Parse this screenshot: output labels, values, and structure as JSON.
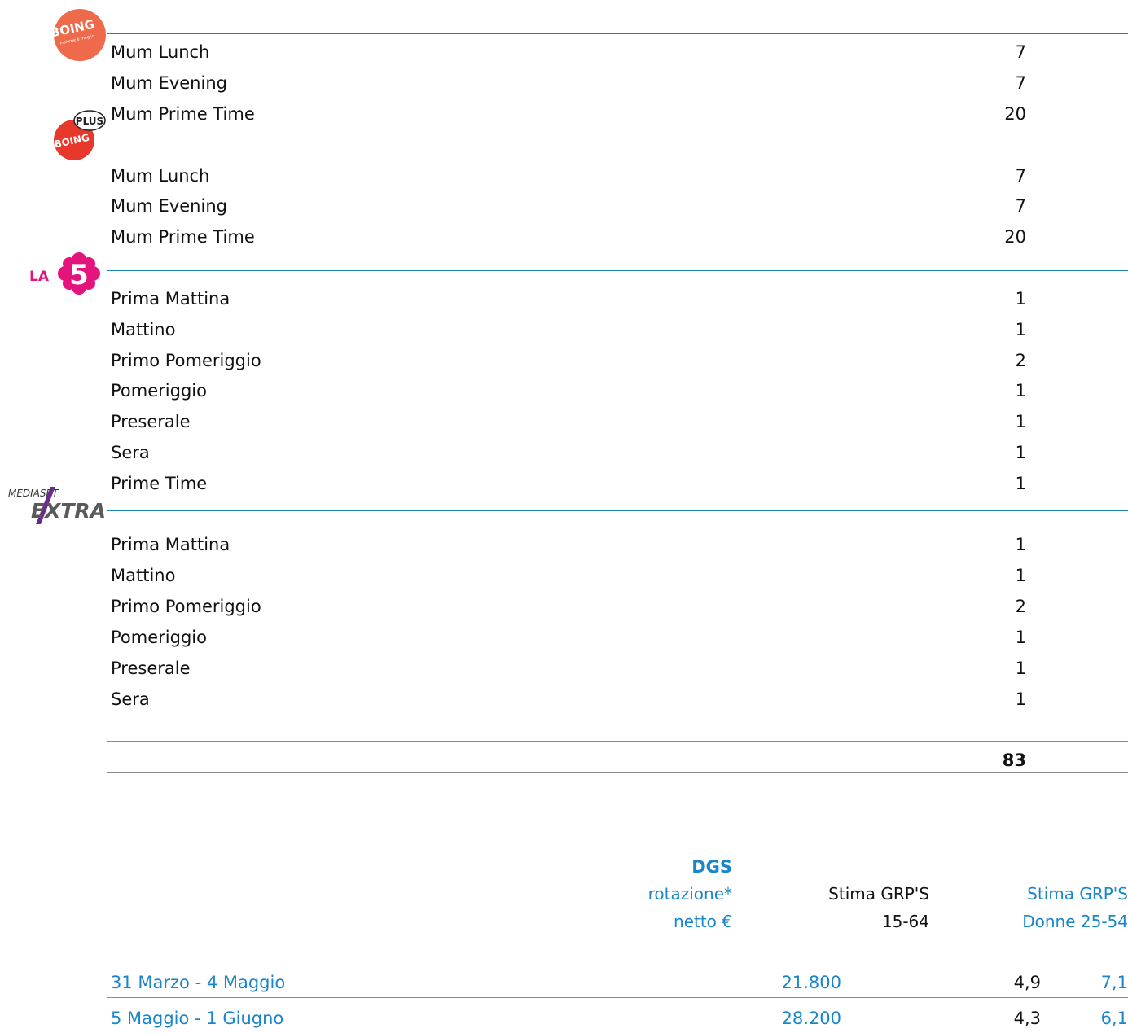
{
  "logos": {
    "boing": {
      "name": "BOING",
      "tagline": "Insieme è meglio"
    },
    "boing_plus": {
      "name": "BOING",
      "badge": "PLUS"
    },
    "la5": {
      "prefix": "LA",
      "number": "5"
    },
    "mediaset_extra": {
      "top": "MEDIASET",
      "name": "EXTRA"
    }
  },
  "sections": [
    {
      "rows": [
        {
          "label": "Mum Lunch",
          "value": "7"
        },
        {
          "label": "Mum Evening",
          "value": "7"
        },
        {
          "label": "Mum Prime Time",
          "value": "20"
        }
      ]
    },
    {
      "rows": [
        {
          "label": "Mum Lunch",
          "value": "7"
        },
        {
          "label": "Mum Evening",
          "value": "7"
        },
        {
          "label": "Mum Prime Time",
          "value": "20"
        }
      ]
    },
    {
      "rows": [
        {
          "label": "Prima Mattina",
          "value": "1"
        },
        {
          "label": "Mattino",
          "value": "1"
        },
        {
          "label": "Primo Pomeriggio",
          "value": "2"
        },
        {
          "label": "Pomeriggio",
          "value": "1"
        },
        {
          "label": "Preserale",
          "value": "1"
        },
        {
          "label": "Sera",
          "value": "1"
        },
        {
          "label": "Prime Time",
          "value": "1"
        }
      ]
    },
    {
      "rows": [
        {
          "label": "Prima Mattina",
          "value": "1"
        },
        {
          "label": "Mattino",
          "value": "1"
        },
        {
          "label": "Primo Pomeriggio",
          "value": "2"
        },
        {
          "label": "Pomeriggio",
          "value": "1"
        },
        {
          "label": "Preserale",
          "value": "1"
        },
        {
          "label": "Sera",
          "value": "1"
        }
      ]
    }
  ],
  "total": "83",
  "pricing": {
    "headers": {
      "col1_title": "DGS",
      "col1_line2": "rotazione*",
      "col1_line3": "netto €",
      "col2_line1": "Stima GRP'S",
      "col2_line2": "15-64",
      "col3_line1": "Stima GRP'S",
      "col3_line2": "Donne 25-54"
    },
    "rows": [
      {
        "period": "31 Marzo - 4 Maggio",
        "price": "21.800",
        "grp_1564": "4,9",
        "grp_donne": "7,1"
      },
      {
        "period": "5 Maggio - 1 Giugno",
        "price": "28.200",
        "grp_1564": "4,3",
        "grp_donne": "6,1"
      }
    ]
  },
  "colors": {
    "accent_blue": "#1a86c9",
    "rule_blue": "#1a86b8",
    "boing_orange": "#ee6a4a",
    "boing_plus_red": "#e8382c",
    "la5_magenta": "#e5147c"
  }
}
